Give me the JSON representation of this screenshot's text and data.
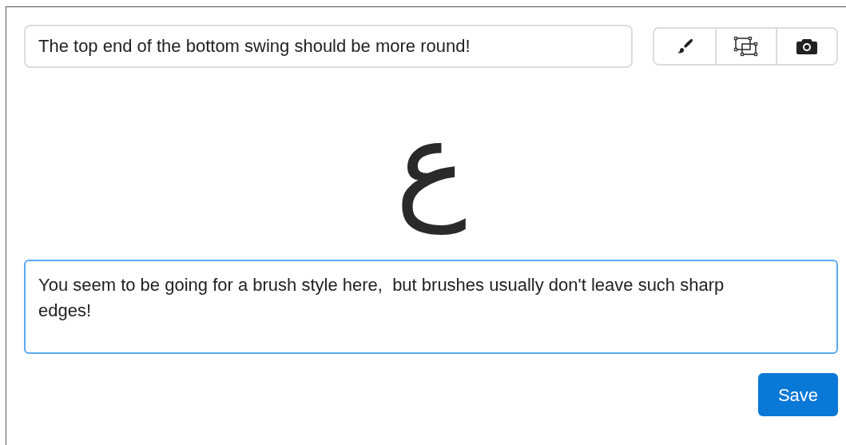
{
  "title_field": {
    "value": "The top end of the bottom swing should be more round!"
  },
  "tools": [
    {
      "kind": "brush"
    },
    {
      "kind": "selection"
    },
    {
      "kind": "camera"
    }
  ],
  "glyph": "ع",
  "comment_field": {
    "value": "You seem to be going for a brush style here,  but brushes usually don't leave such sharp edges!",
    "focused": true
  },
  "save_button": "Save"
}
